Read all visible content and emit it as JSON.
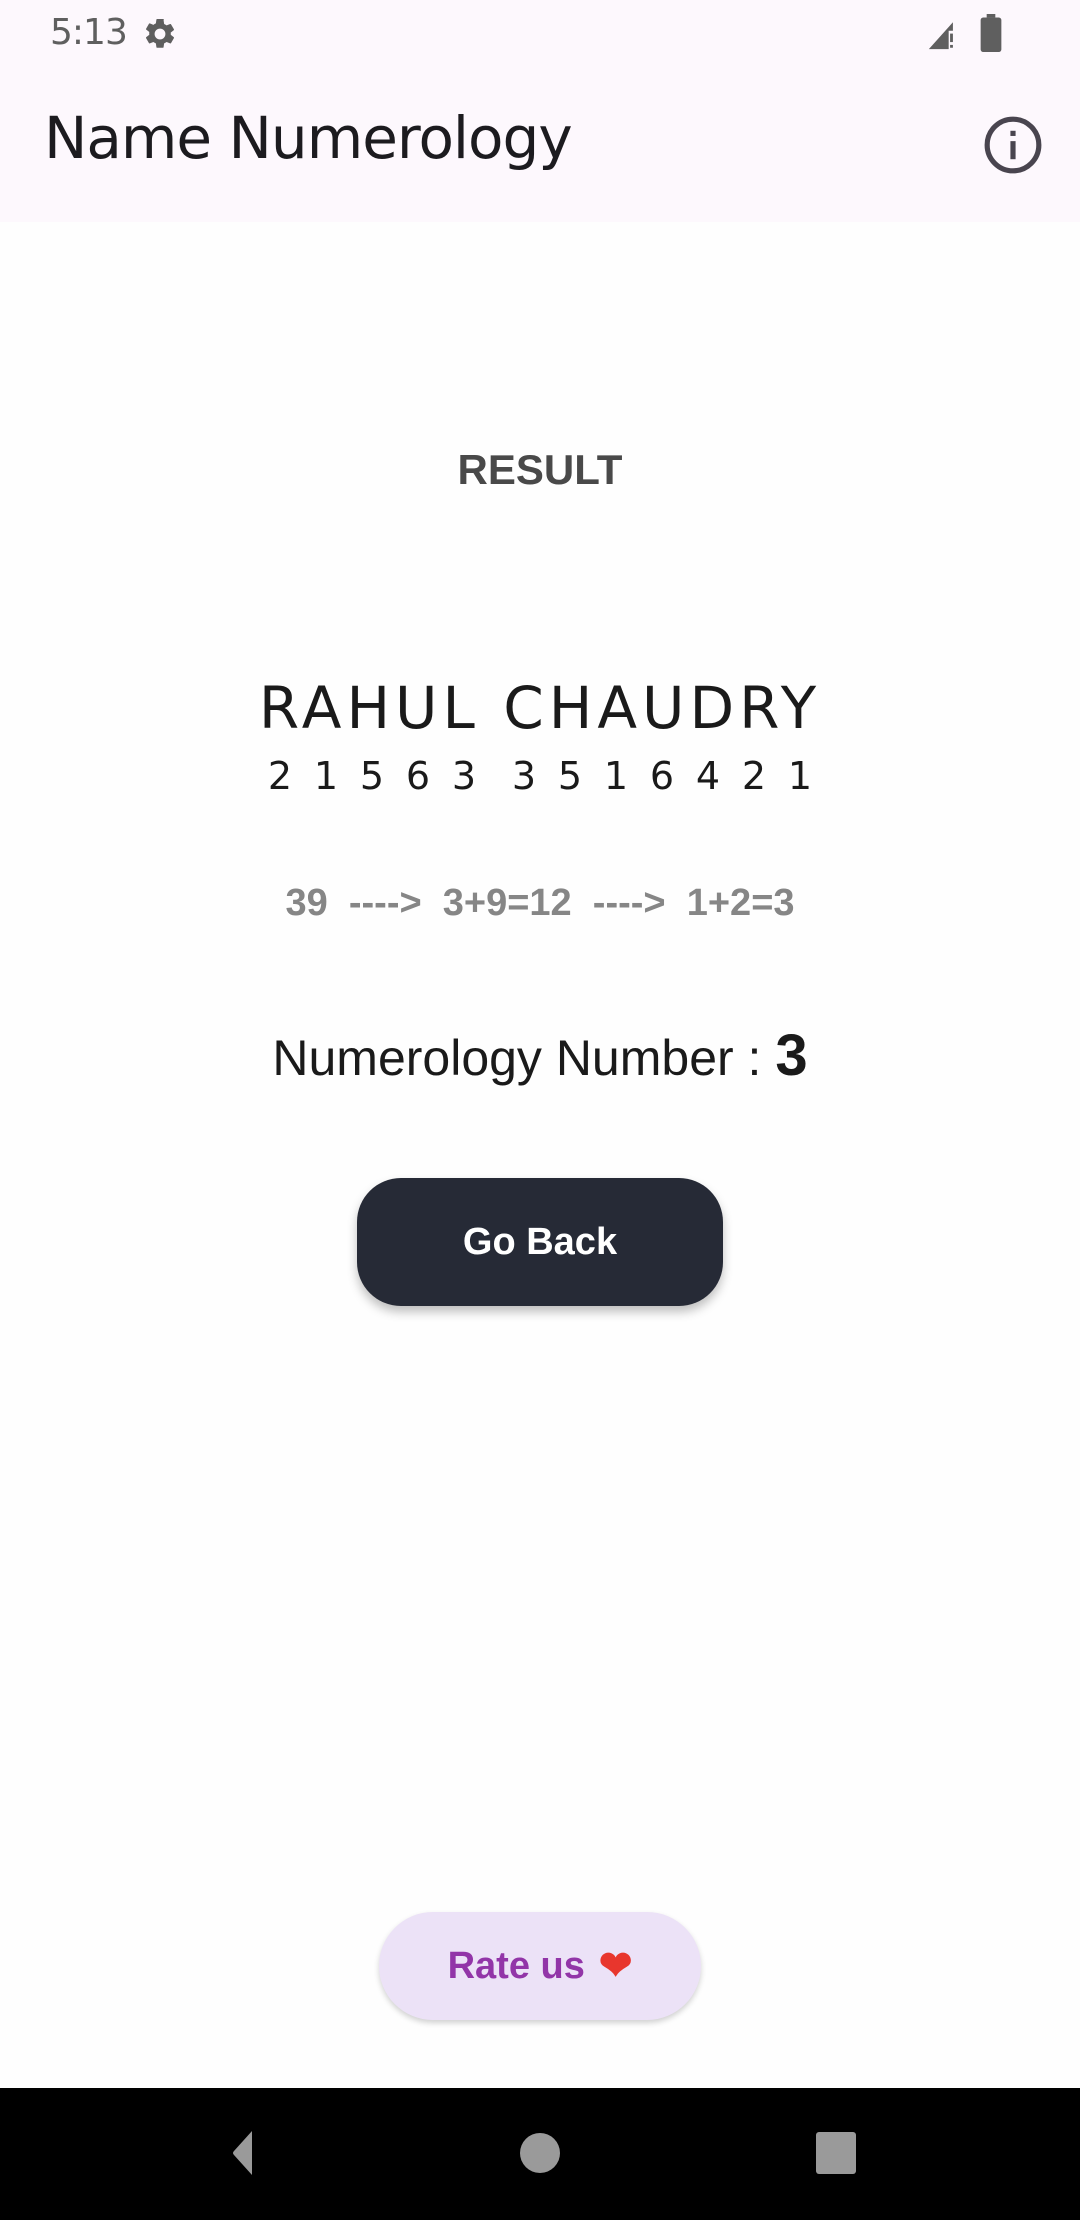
{
  "status_bar": {
    "time": "5:13",
    "icons": [
      "gear-icon",
      "signal-icon",
      "battery-icon"
    ]
  },
  "app_bar": {
    "title": "Name Numerology",
    "action_icon": "info-icon"
  },
  "result": {
    "heading": "RESULT",
    "name": "RAHUL CHAUDRY",
    "first_name_digits": [
      "2",
      "1",
      "5",
      "6",
      "3"
    ],
    "last_name_digits": [
      "3",
      "5",
      "1",
      "6",
      "4",
      "2",
      "1"
    ],
    "reduction_line": "39  ---->  3+9=12  ---->  1+2=3",
    "numerology_label": "Numerology Number : ",
    "numerology_value": "3"
  },
  "buttons": {
    "go_back": "Go Back",
    "rate_us": "Rate us",
    "rate_us_emoji": "❤"
  },
  "colors": {
    "go_back_bg": "#262a36",
    "rate_us_bg": "#ece2f7",
    "rate_us_text": "#9235a8",
    "heart": "#e8362d"
  },
  "nav_bar": {
    "items": [
      "back-icon",
      "home-icon",
      "recents-icon"
    ]
  }
}
